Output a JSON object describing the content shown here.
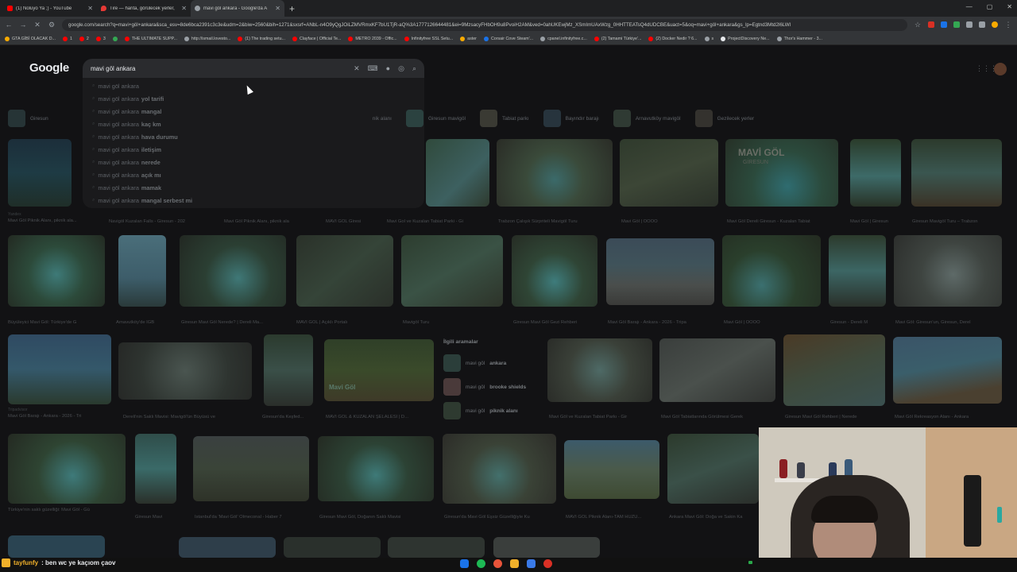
{
  "tabs": [
    {
      "title": "(1) Noluyo Ya ;) - YouTube",
      "color": "#ff0000",
      "active": false
    },
    {
      "title": "Tire — harita, görülecek yerler,",
      "color": "#e53935",
      "active": false
    },
    {
      "title": "mavi göl ankara - Google'da A",
      "color": "#9aa0a6",
      "active": true
    }
  ],
  "address": "google.com/search?q=mavi+göl+ankara&sca_esv=8de6bca2391c3c3e&udm=2&biw=2560&bih=1271&sxsrf=ANbL-n4O9yQgJOiLZMVRmxKF7bU1TjR-aQ%3A1777126644481&ei=9MzsacyFHbOH9u8PvoiH2AM&ved=0ahUKEwjMz_XSmImUAxWzg_0HHTTEATsQ4dUDCBE&uact=5&oq=mavi+göl+ankara&gs_lp=Egtnd3Mtd2l6LWl",
  "bookmarks": [
    "GTA GİBİ OLACAK D...",
    "1",
    "2",
    "3",
    "THE ULTIMATE SUPP...",
    "http://ismail.lovesto...",
    "(1) The trading setu...",
    "Clayface | Official Te...",
    "METRO 2039 - Offic...",
    "Infinityfree SSL Setu...",
    "aster",
    "Corsair Cove Steam'...",
    "cpanel.infinityfree.c...",
    "(2) Tamami Türkiye'...",
    "(2) Docker Nedir ? 6...",
    "s",
    "ProjectDiscovery Ne...",
    "Thor's Hammer - 3..."
  ],
  "logo": "Google",
  "search": {
    "query": "mavi göl ankara"
  },
  "suggestions": [
    {
      "base": "mavi göl ankara",
      "bold": ""
    },
    {
      "base": "mavi göl ankara",
      "bold": "yol tarifi"
    },
    {
      "base": "mavi göl ankara",
      "bold": "mangal"
    },
    {
      "base": "mavi göl ankara",
      "bold": "kaç km"
    },
    {
      "base": "mavi göl ankara",
      "bold": "hava durumu"
    },
    {
      "base": "mavi göl ankara",
      "bold": "iletişim"
    },
    {
      "base": "mavi göl ankara",
      "bold": "nerede"
    },
    {
      "base": "mavi göl ankara",
      "bold": "açık mı"
    },
    {
      "base": "mavi göl ankara",
      "bold": "mamak"
    },
    {
      "base": "mavi göl ankara",
      "bold": "mangal serbest mi"
    }
  ],
  "chips": [
    "Giresun",
    "",
    "nik alanı",
    "Giresun mavigöl",
    "Tabiat parkı",
    "Bayındır barajı",
    "Arnavutköy mavigöl",
    "Gezilecek yerler"
  ],
  "captions_row1": [
    "Yandex",
    "Mavi Göl Piknik Alanı, piknik ala...",
    "Navigöl Kuzalan Falls - Giresun - 202",
    "Mavi Göl Piknik Alanı, piknik ala",
    "MAVİ GÖL Giresi",
    "Mavi Gol ve Kuzalan Tabiat Parki - Gi",
    "Trabzon Çalışık Sürpriteli Mavigöl Turu",
    "Mavi Göl | OOOO",
    "Mavi Göl Dereli Giresun - Kuzalan Tabiat",
    "Mavi Göl | Giresun",
    "Giresun Mavigöl Turu – Trabzon"
  ],
  "captions_row2": [
    "Büyüleyici Mavi Göl: Türkiye'de G",
    "Arnavutköy'de IGB",
    "Giresun Mavi Göl Nerede? | Dereli Ma...",
    "MAVİ GÖL | Açıklı Portalı",
    "Mavigöl Turu",
    "Giresun Mavi Göl Gezi Rehberi",
    "Mavi Göl Barajı - Ankara - 2026 - Tripa",
    "Mavi Göl | OOOO",
    "Giresun - Dereli M",
    "Mavi Göl: Giresun'un, Giresun, Derel"
  ],
  "captions_row3": [
    "Mavi Göl Barajı - Ankara - 2026 - Tri",
    "Dereli'nin Saklı Mavisi: Mavigöl'ün Büyüsü ve",
    "Giresun'da Keşfed...",
    "MAVİ GÖL & KUZALAN ŞELALESİ | D...",
    "Mavi Göl ve Kuzalan Tabiat Parkı - Gir",
    "Mavi Göl Tabiatlarında Görülmesi Gerek",
    "Giresun Mavi Göl Rehberi | Nerede",
    "Mavi Göl Rekreasyon Alanı - Ankara"
  ],
  "captions_row4": [
    "Türkiye'nin saklı güzelliği: Mavi Göl - Gü",
    "Giresun Mavi",
    "İstanbul'da 'Mavi Göl' Ölmeconal - Haber 7",
    "Giresun Mavi Göl, Doğanın Saklı Mavisi",
    "Giresun'da Mavi Göl Eşsiz Güzelliğiyle Ku",
    "MAVİ GÖL Piknik Alanı-TAM HUZU...",
    "Ankara Mavi Göl: Doğa ve Sakin Ka"
  ],
  "related": {
    "heading": "İlgili aramalar",
    "items": [
      {
        "text": "mavi göl",
        "bold": "ankara"
      },
      {
        "text": "mavi göl",
        "bold": "brooke shields"
      },
      {
        "text": "mavi göl",
        "bold": "piknik alanı"
      }
    ]
  },
  "overlay_text": [
    "MAVİ GÖL",
    "GİRESUN",
    "Mavi Göl"
  ],
  "chat": {
    "user": "tayfunfy",
    "message": ": ben wc ye kaçıom çaov"
  }
}
